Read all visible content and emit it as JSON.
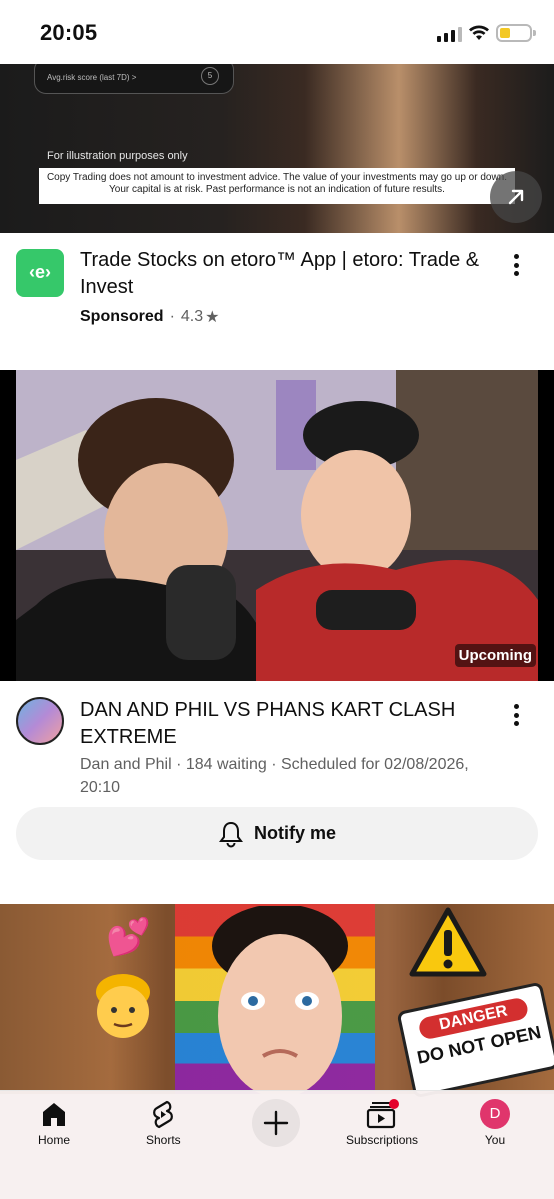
{
  "status_bar": {
    "time": "20:05"
  },
  "ad": {
    "card_text": "Avg.risk score (last 7D) >",
    "card_value": "5",
    "illustration_note": "For illustration purposes only",
    "disclaimer": "Copy Trading does not amount to investment advice. The value of your investments may go up or down. Your capital is at risk. Past performance is not an indication of future results.",
    "logo_text": "‹e›",
    "title": "Trade Stocks on etoro™ App | etoro: Trade & Invest",
    "sponsored_label": "Sponsored",
    "separator": "·",
    "rating": "4.3",
    "rating_star": "★",
    "brand_color": "#36c86a"
  },
  "video": {
    "badge": "Upcoming",
    "title": "DAN AND PHIL VS PHANS KART CLASH EXTREME",
    "meta": "Dan and Phil · 184 waiting · Scheduled for 02/08/2026, 20:10",
    "notify_label": "Notify me"
  },
  "thumb3": {
    "danger_top": "DANGER",
    "danger_bottom": "DO NOT OPEN"
  },
  "nav": {
    "home": "Home",
    "shorts": "Shorts",
    "subscriptions": "Subscriptions",
    "you": "You",
    "you_initial": "D"
  }
}
